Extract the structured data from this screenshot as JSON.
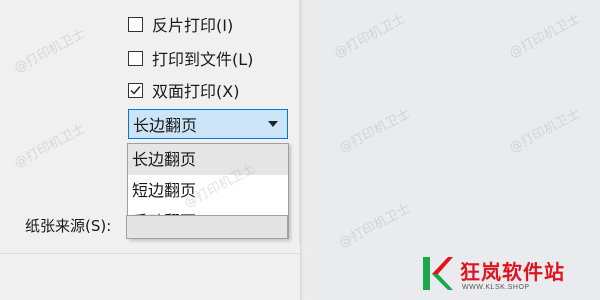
{
  "print_dialog": {
    "options": [
      {
        "label": "反片打印(I)",
        "checked": false
      },
      {
        "label": "打印到文件(L)",
        "checked": false
      },
      {
        "label": "双面打印(X)",
        "checked": true
      }
    ],
    "duplex_mode": {
      "selected": "长边翻页",
      "options": [
        "长边翻页",
        "短边翻页",
        "手动翻页"
      ]
    },
    "paper_source_label": "纸张来源(S):"
  },
  "watermark": "@打印机卫士",
  "logo": {
    "name": "狂岚软件站",
    "url": "WWW.KLSK.SHOP"
  },
  "colors": {
    "combo_border": "#0078d7",
    "combo_fill": "#cce4f7",
    "hover": "#e5e5e5",
    "brand_red": "#e0141e",
    "brand_green": "#1aa84a"
  }
}
